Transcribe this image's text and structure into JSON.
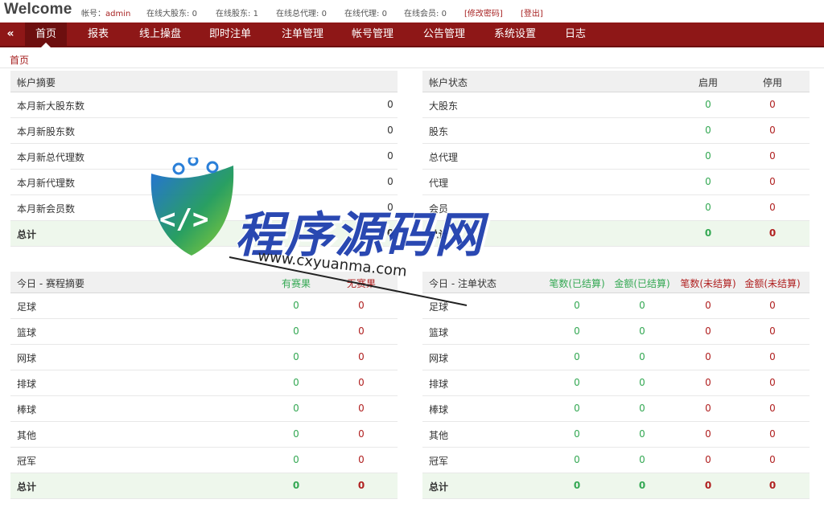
{
  "header": {
    "welcome": "Welcome",
    "info": [
      {
        "key": "user",
        "label": "帐号：",
        "value": "admin"
      },
      {
        "key": "online_big",
        "label": "在线大股东: ",
        "value": "0"
      },
      {
        "key": "online_holder",
        "label": "在线股东: ",
        "value": "1"
      },
      {
        "key": "online_general",
        "label": "在线总代理: ",
        "value": "0"
      },
      {
        "key": "online_agent",
        "label": "在线代理: ",
        "value": "0"
      },
      {
        "key": "online_member",
        "label": "在线会员: ",
        "value": "0"
      }
    ],
    "change_password": "[修改密码]",
    "logout": "[登出]"
  },
  "nav": {
    "collapse_icon": "«",
    "items": [
      "首页",
      "报表",
      "线上操盘",
      "即时注单",
      "注单管理",
      "帐号管理",
      "公告管理",
      "系统设置",
      "日志"
    ],
    "active_index": 0
  },
  "breadcrumb": "首页",
  "colors": {
    "brand": "#8e1717",
    "accent_text": "#a72222",
    "enabled": "#34a853",
    "disabled": "#b02020",
    "total_row_bg": "#eef7ec"
  },
  "account_summary": {
    "title": "帐户摘要",
    "rows": [
      {
        "label": "本月新大股东数",
        "value": "0"
      },
      {
        "label": "本月新股东数",
        "value": "0"
      },
      {
        "label": "本月新总代理数",
        "value": "0"
      },
      {
        "label": "本月新代理数",
        "value": "0"
      },
      {
        "label": "本月新会员数",
        "value": "0"
      },
      {
        "label": "总计",
        "value": "0",
        "total": true
      }
    ]
  },
  "account_status": {
    "title": "帐户状态",
    "columns": [
      "启用",
      "停用"
    ],
    "rows": [
      {
        "label": "大股东",
        "values": [
          "0",
          "0"
        ]
      },
      {
        "label": "股东",
        "values": [
          "0",
          "0"
        ]
      },
      {
        "label": "总代理",
        "values": [
          "0",
          "0"
        ]
      },
      {
        "label": "代理",
        "values": [
          "0",
          "0"
        ]
      },
      {
        "label": "会员",
        "values": [
          "0",
          "0"
        ]
      },
      {
        "label": "总计",
        "values": [
          "0",
          "0"
        ],
        "total": true
      }
    ]
  },
  "schedule_summary": {
    "title": "今日 - 赛程摘要",
    "columns": [
      "有赛果",
      "无赛果"
    ],
    "rows": [
      {
        "label": "足球",
        "values": [
          "0",
          "0"
        ]
      },
      {
        "label": "篮球",
        "values": [
          "0",
          "0"
        ]
      },
      {
        "label": "网球",
        "values": [
          "0",
          "0"
        ]
      },
      {
        "label": "排球",
        "values": [
          "0",
          "0"
        ]
      },
      {
        "label": "棒球",
        "values": [
          "0",
          "0"
        ]
      },
      {
        "label": "其他",
        "values": [
          "0",
          "0"
        ]
      },
      {
        "label": "冠军",
        "values": [
          "0",
          "0"
        ]
      },
      {
        "label": "总计",
        "values": [
          "0",
          "0"
        ],
        "total": true
      }
    ]
  },
  "bet_status": {
    "title": "今日 - 注单状态",
    "columns": [
      "笔数(已结算)",
      "金额(已结算)",
      "笔数(未结算)",
      "金额(未结算)"
    ],
    "rows": [
      {
        "label": "足球",
        "values": [
          "0",
          "0",
          "0",
          "0"
        ]
      },
      {
        "label": "篮球",
        "values": [
          "0",
          "0",
          "0",
          "0"
        ]
      },
      {
        "label": "网球",
        "values": [
          "0",
          "0",
          "0",
          "0"
        ]
      },
      {
        "label": "排球",
        "values": [
          "0",
          "0",
          "0",
          "0"
        ]
      },
      {
        "label": "棒球",
        "values": [
          "0",
          "0",
          "0",
          "0"
        ]
      },
      {
        "label": "其他",
        "values": [
          "0",
          "0",
          "0",
          "0"
        ]
      },
      {
        "label": "冠军",
        "values": [
          "0",
          "0",
          "0",
          "0"
        ]
      },
      {
        "label": "总计",
        "values": [
          "0",
          "0",
          "0",
          "0"
        ],
        "total": true
      }
    ]
  },
  "watermark": {
    "brand": "程序源码网",
    "url": "www.cxyuanma.com",
    "logo_icon": "code-shield-icon"
  }
}
